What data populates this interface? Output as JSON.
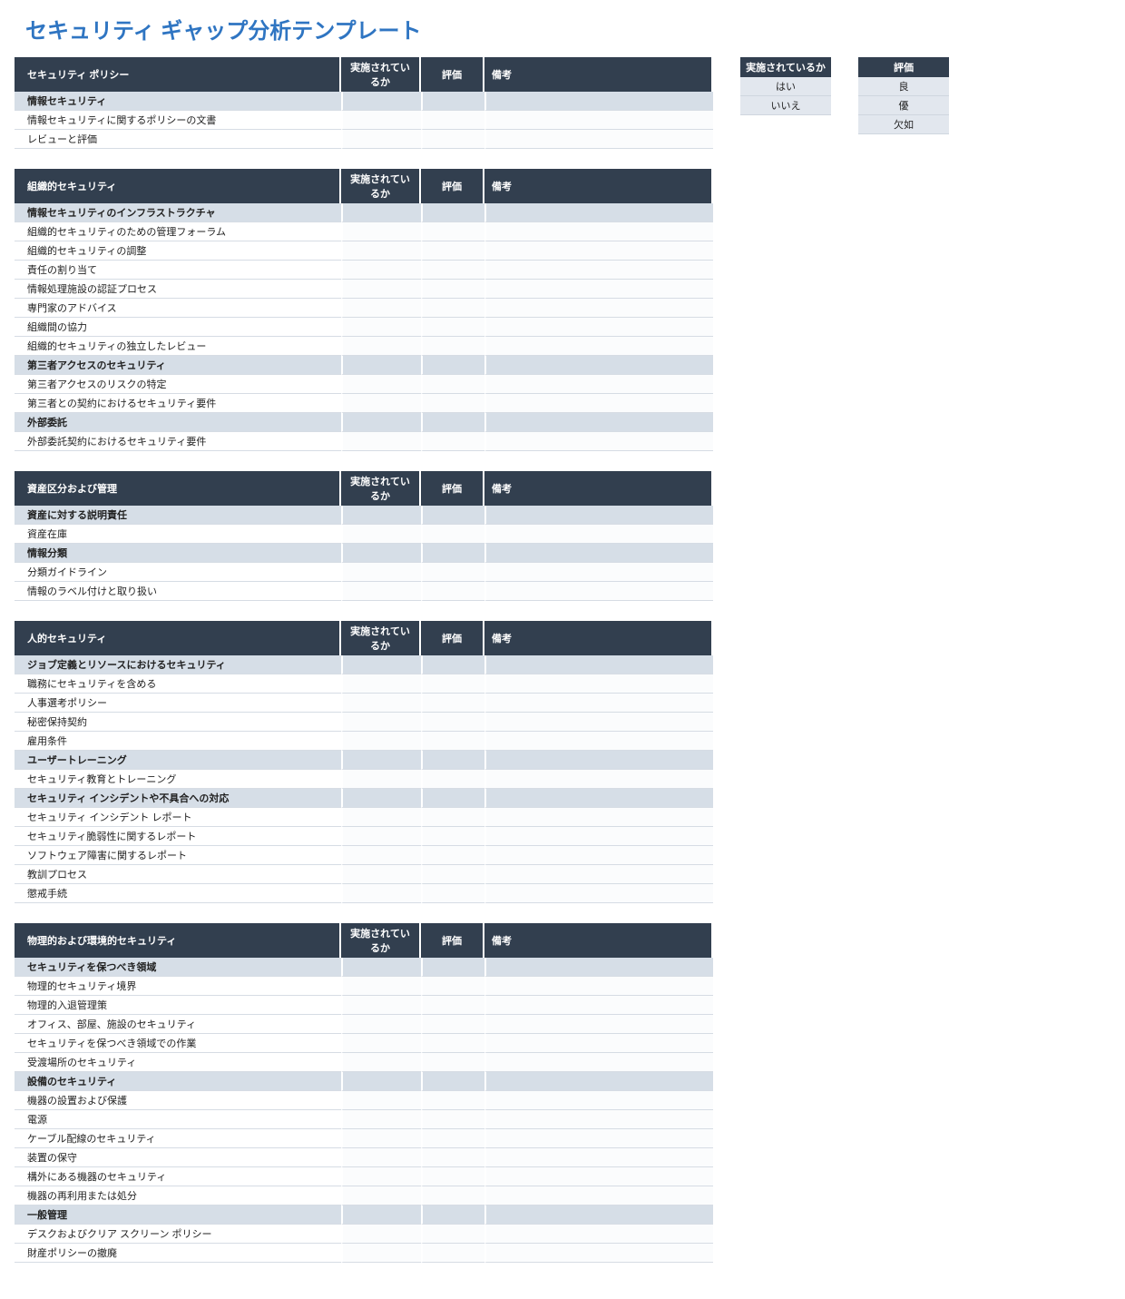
{
  "title": "セキュリティ ギャップ分析テンプレート",
  "columns": {
    "implemented": "実施されているか",
    "rating": "評価",
    "notes": "備考"
  },
  "legends": {
    "implemented": {
      "header": "実施されているか",
      "options": [
        "はい",
        "いいえ"
      ]
    },
    "rating": {
      "header": "評価",
      "options": [
        "良",
        "優",
        "欠如"
      ]
    }
  },
  "sections": [
    {
      "header": "セキュリティ ポリシー",
      "rows": [
        {
          "type": "sub",
          "text": "情報セキュリティ"
        },
        {
          "type": "item",
          "text": "情報セキュリティに関するポリシーの文書"
        },
        {
          "type": "item",
          "text": "レビューと評価"
        }
      ]
    },
    {
      "header": "組織的セキュリティ",
      "rows": [
        {
          "type": "sub",
          "text": "情報セキュリティのインフラストラクチャ"
        },
        {
          "type": "item",
          "text": "組織的セキュリティのための管理フォーラム"
        },
        {
          "type": "item",
          "text": "組織的セキュリティの調整"
        },
        {
          "type": "item",
          "text": "責任の割り当て"
        },
        {
          "type": "item",
          "text": "情報処理施設の認証プロセス"
        },
        {
          "type": "item",
          "text": "専門家のアドバイス"
        },
        {
          "type": "item",
          "text": "組織間の協力"
        },
        {
          "type": "item",
          "text": "組織的セキュリティの独立したレビュー"
        },
        {
          "type": "sub",
          "text": "第三者アクセスのセキュリティ"
        },
        {
          "type": "item",
          "text": "第三者アクセスのリスクの特定"
        },
        {
          "type": "item",
          "text": "第三者との契約におけるセキュリティ要件"
        },
        {
          "type": "sub",
          "text": "外部委託"
        },
        {
          "type": "item",
          "text": "外部委託契約におけるセキュリティ要件"
        }
      ]
    },
    {
      "header": "資産区分および管理",
      "rows": [
        {
          "type": "sub",
          "text": "資産に対する説明責任"
        },
        {
          "type": "item",
          "text": "資産在庫"
        },
        {
          "type": "sub",
          "text": "情報分類"
        },
        {
          "type": "item",
          "text": "分類ガイドライン"
        },
        {
          "type": "item",
          "text": "情報のラベル付けと取り扱い"
        }
      ]
    },
    {
      "header": "人的セキュリティ",
      "rows": [
        {
          "type": "sub",
          "text": "ジョブ定義とリソースにおけるセキュリティ"
        },
        {
          "type": "item",
          "text": "職務にセキュリティを含める"
        },
        {
          "type": "item",
          "text": "人事選考ポリシー"
        },
        {
          "type": "item",
          "text": "秘密保持契約"
        },
        {
          "type": "item",
          "text": "雇用条件"
        },
        {
          "type": "sub",
          "text": "ユーザートレーニング"
        },
        {
          "type": "item",
          "text": "セキュリティ教育とトレーニング"
        },
        {
          "type": "sub",
          "text": "セキュリティ インシデントや不具合への対応"
        },
        {
          "type": "item",
          "text": "セキュリティ インシデント レポート"
        },
        {
          "type": "item",
          "text": "セキュリティ脆弱性に関するレポート"
        },
        {
          "type": "item",
          "text": "ソフトウェア障害に関するレポート"
        },
        {
          "type": "item",
          "text": "教訓プロセス"
        },
        {
          "type": "item",
          "text": "懲戒手続"
        }
      ]
    },
    {
      "header": "物理的および環境的セキュリティ",
      "rows": [
        {
          "type": "sub",
          "text": "セキュリティを保つべき領域"
        },
        {
          "type": "item",
          "text": "物理的セキュリティ境界"
        },
        {
          "type": "item",
          "text": "物理的入退管理策"
        },
        {
          "type": "item",
          "text": "オフィス、部屋、施設のセキュリティ"
        },
        {
          "type": "item",
          "text": "セキュリティを保つべき領域での作業"
        },
        {
          "type": "item",
          "text": "受渡場所のセキュリティ"
        },
        {
          "type": "sub",
          "text": "設備のセキュリティ"
        },
        {
          "type": "item",
          "text": "機器の設置および保護"
        },
        {
          "type": "item",
          "text": "電源"
        },
        {
          "type": "item",
          "text": "ケーブル配線のセキュリティ"
        },
        {
          "type": "item",
          "text": "装置の保守"
        },
        {
          "type": "item",
          "text": "構外にある機器のセキュリティ"
        },
        {
          "type": "item",
          "text": "機器の再利用または処分"
        },
        {
          "type": "sub",
          "text": "一般管理"
        },
        {
          "type": "item",
          "text": "デスクおよびクリア スクリーン ポリシー"
        },
        {
          "type": "item",
          "text": "財産ポリシーの撤廃"
        }
      ]
    }
  ]
}
